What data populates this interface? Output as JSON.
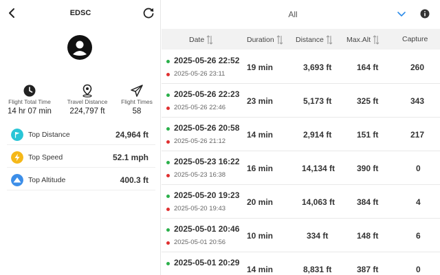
{
  "header": {
    "title": "EDSC"
  },
  "stats": [
    {
      "icon": "clock-icon",
      "label": "Flight Total Time",
      "value": "14 hr 07 min"
    },
    {
      "icon": "location-pin-icon",
      "label": "Travel Distance",
      "value": "224,797 ft"
    },
    {
      "icon": "paper-plane-icon",
      "label": "Flight Times",
      "value": "58"
    }
  ],
  "metrics": [
    {
      "icon": "flag-icon",
      "color": "#29c5d6",
      "label": "Top Distance",
      "value": "24,964 ft"
    },
    {
      "icon": "lightning-icon",
      "color": "#f5b819",
      "label": "Top Speed",
      "value": "52.1 mph"
    },
    {
      "icon": "mountain-icon",
      "color": "#3c8ee8",
      "label": "Top Altitude",
      "value": "400.3 ft"
    }
  ],
  "filter": {
    "value": "All"
  },
  "table": {
    "columns": [
      "Date",
      "Duration",
      "Distance",
      "Max.Alt",
      "Capture"
    ],
    "rows": [
      {
        "start": "2025-05-26 22:52",
        "end": "2025-05-26 23:11",
        "duration": "19 min",
        "distance": "3,693 ft",
        "max_alt": "164 ft",
        "capture": "260"
      },
      {
        "start": "2025-05-26 22:23",
        "end": "2025-05-26 22:46",
        "duration": "23 min",
        "distance": "5,173 ft",
        "max_alt": "325 ft",
        "capture": "343"
      },
      {
        "start": "2025-05-26 20:58",
        "end": "2025-05-26 21:12",
        "duration": "14 min",
        "distance": "2,914 ft",
        "max_alt": "151 ft",
        "capture": "217"
      },
      {
        "start": "2025-05-23 16:22",
        "end": "2025-05-23 16:38",
        "duration": "16 min",
        "distance": "14,134 ft",
        "max_alt": "390 ft",
        "capture": "0"
      },
      {
        "start": "2025-05-20 19:23",
        "end": "2025-05-20 19:43",
        "duration": "20 min",
        "distance": "14,063 ft",
        "max_alt": "384 ft",
        "capture": "4"
      },
      {
        "start": "2025-05-01 20:46",
        "end": "2025-05-01 20:56",
        "duration": "10 min",
        "distance": "334 ft",
        "max_alt": "148 ft",
        "capture": "6"
      },
      {
        "start": "2025-05-01 20:29",
        "end": "",
        "duration": "14 min",
        "distance": "8,831 ft",
        "max_alt": "387 ft",
        "capture": "0"
      }
    ]
  }
}
